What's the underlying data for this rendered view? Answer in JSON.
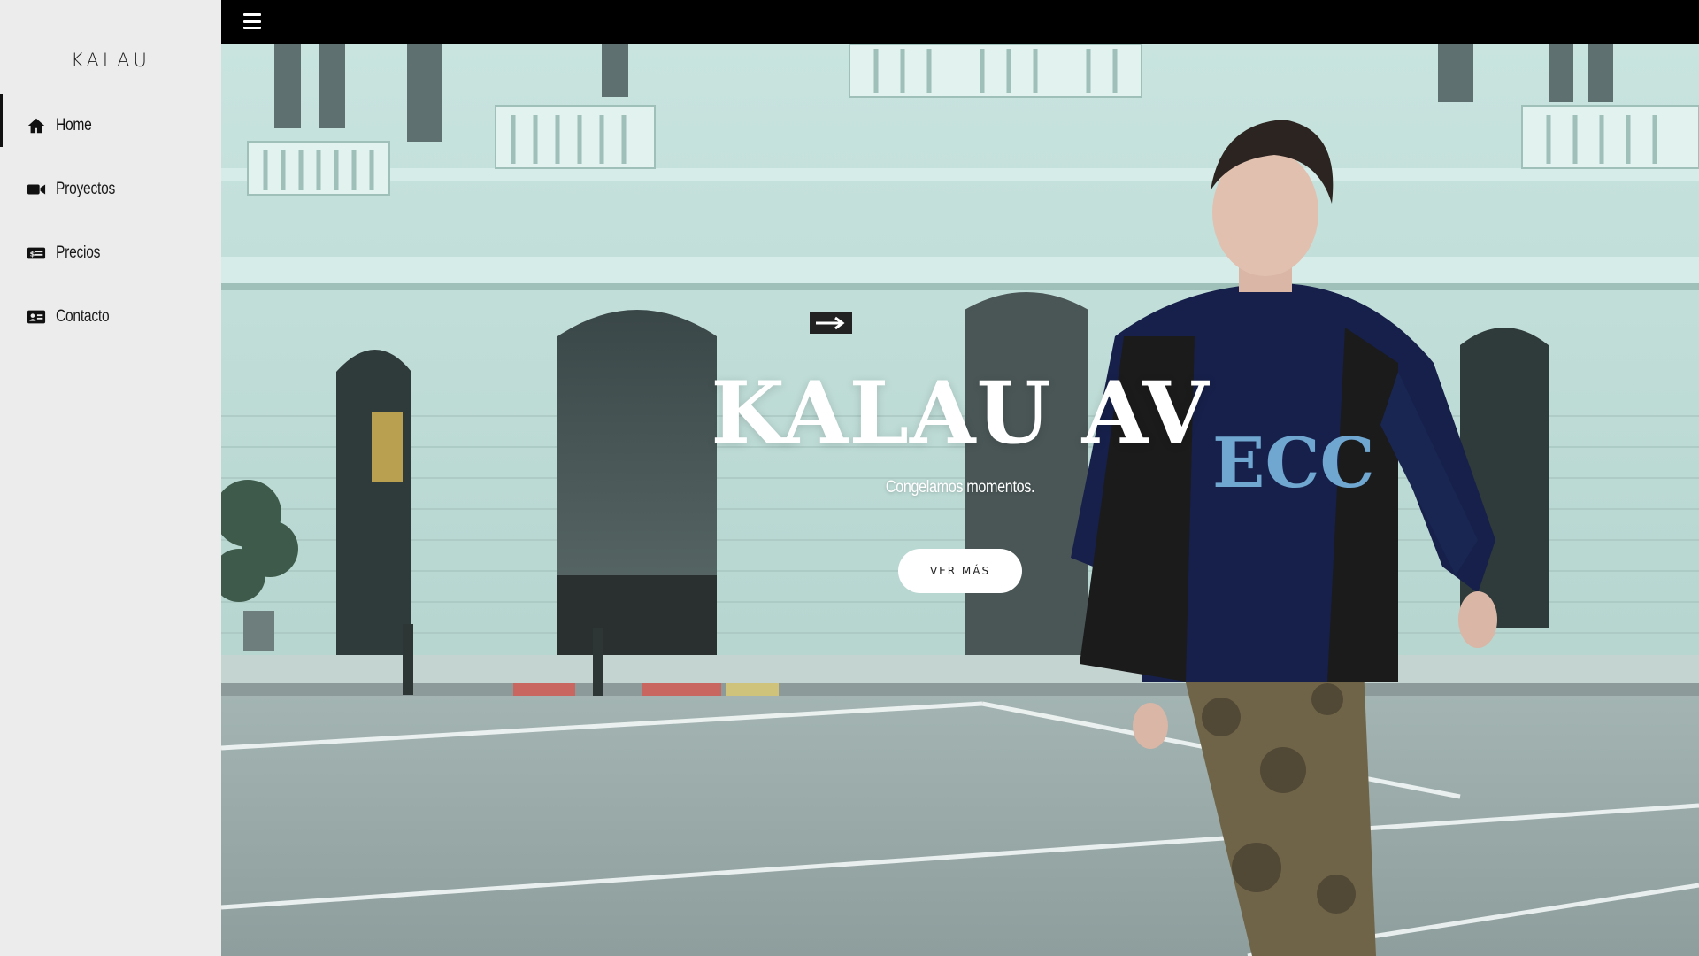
{
  "sidebar": {
    "brand": "KALAU",
    "items": [
      {
        "label": "Home",
        "icon": "home-icon",
        "active": true
      },
      {
        "label": "Proyectos",
        "icon": "video-camera-icon",
        "active": false
      },
      {
        "label": "Precios",
        "icon": "money-bill-icon",
        "active": false
      },
      {
        "label": "Contacto",
        "icon": "address-card-icon",
        "active": false
      }
    ]
  },
  "topbar": {
    "menu_icon": "hamburger-menu-icon"
  },
  "hero": {
    "title": "KALAU AV",
    "subtitle": "Congelamos momentos.",
    "button_label": "VER MÁS"
  },
  "colors": {
    "sidebar_bg": "#ececec",
    "topbar_bg": "#000000",
    "accent": "#111111",
    "hero_text": "#ffffff"
  }
}
